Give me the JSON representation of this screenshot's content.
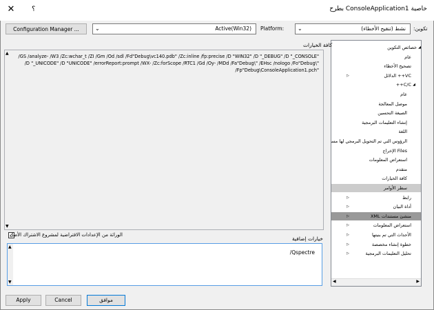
{
  "window": {
    "title": "خاصية ConsoleApplication1 بطرح",
    "help": "؟",
    "close": "✕"
  },
  "toolbar": {
    "config_label": "تكوين:",
    "config_value": "نشط (تنقيح الأخطاء)",
    "platform_label": "Platform:",
    "platform_value": "Active(Win32)",
    "config_manager": "Configuration Manager ..."
  },
  "tree": {
    "items": [
      {
        "label": "خصائص التكوين",
        "expanded": true
      },
      {
        "label": "عام"
      },
      {
        "label": "تصحيح الأخطاء"
      },
      {
        "label": "VC++ الدلائل",
        "arrow": "▶"
      },
      {
        "label": "C/C++",
        "expanded": true
      },
      {
        "label": "عام"
      },
      {
        "label": "موصل المعالجة"
      },
      {
        "label": "الصيغة التحسين"
      },
      {
        "label": "إنشاء التعليمات البرمجية"
      },
      {
        "label": "اللغة"
      },
      {
        "label": "الرؤوس التي تم التحويل البرمجي لها مسبقاً"
      },
      {
        "label": "Files الإخراج"
      },
      {
        "label": "استعراض المعلومات"
      },
      {
        "label": "متقدم"
      },
      {
        "label": "كافة الخيارات"
      },
      {
        "label": "سطر الأوامر",
        "selected": true
      },
      {
        "label": "رابط",
        "arrow": "▶"
      },
      {
        "label": "أداة البيان",
        "arrow": "▶"
      },
      {
        "label": "منشئ مستندات XML",
        "arrow": "▶",
        "highlight": true
      },
      {
        "label": "استعراض المعلومات",
        "arrow": "▶"
      },
      {
        "label": "الأحداث التي تم بنيتها",
        "arrow": "▶"
      },
      {
        "label": "خطوة إنشاء مخصصة",
        "arrow": "▶"
      },
      {
        "label": "تحليل التعليمات البرمجية",
        "arrow": "▶"
      }
    ]
  },
  "options": {
    "label": "كافة الخيارات",
    "text": "/GS /analyze- /W3 /Zc:wchar_t /ZI /Gm /Od /sdl /Fd\"Debug\\vc140.pdb\" /Zc:inline /fp:precise /D \"WIN32\" /D \"_DEBUG\" /D \"_CONSOLE\" /D \"_UNICODE\" /D \"UNICODE\" /errorReport:prompt /WX- /Zc:forScope /RTC1 /Gd /Oy- /MDd /Fa\"Debug\\\" /EHsc /nologo /Fo\"Debug\\\" /Fp\"Debug\\ConsoleApplication1.pch\""
  },
  "inherit": {
    "label": "الوراثة من الإعدادات الافتراضية لمشروع الاشتراك الأصل"
  },
  "extra": {
    "label": "خيارات إضافية",
    "value": "/Qspectre"
  },
  "buttons": {
    "ok": "موافق",
    "cancel": "Cancel",
    "apply": "Apply"
  }
}
